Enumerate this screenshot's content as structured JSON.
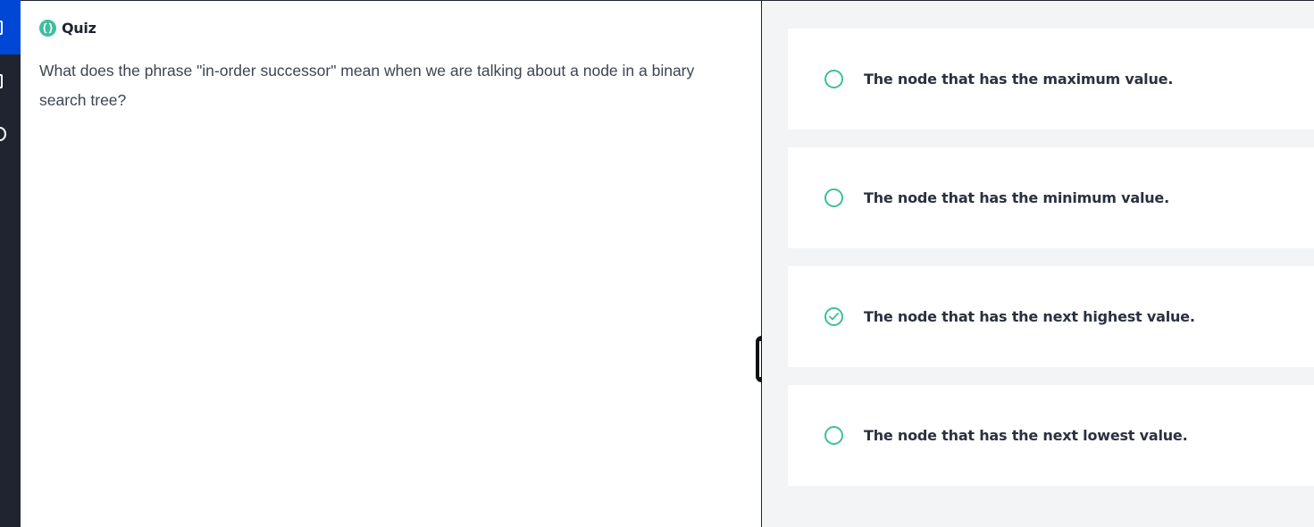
{
  "quiz": {
    "title": "Quiz",
    "icon": "code-braces-icon",
    "accent_color": "#3dbf9e"
  },
  "question": {
    "text": "What does the phrase \"in-order successor\" mean when we are talking about a node in a binary search tree?"
  },
  "options": [
    {
      "label": "The node that has the maximum value.",
      "selected": false
    },
    {
      "label": "The node that has the minimum value.",
      "selected": false
    },
    {
      "label": "The node that has the next highest value.",
      "selected": true
    },
    {
      "label": "The node that has the next lowest value.",
      "selected": false
    }
  ],
  "sidebar": {
    "active_color": "#0047d6",
    "background_color": "#1f2430"
  }
}
